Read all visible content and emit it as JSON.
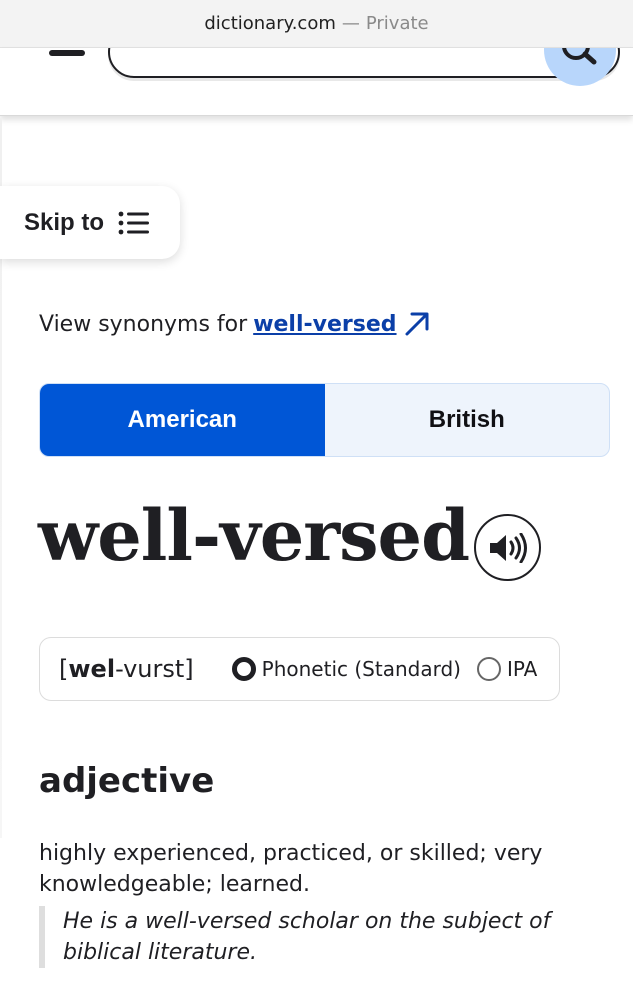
{
  "browser": {
    "domain": "dictionary.com",
    "separator": "—",
    "mode": "Private"
  },
  "header": {
    "menu_icon": "hamburger-icon",
    "search_icon": "search-icon"
  },
  "skip_to": {
    "label": "Skip to",
    "icon": "list-icon"
  },
  "synonyms": {
    "prefix": "View synonyms for",
    "link": "well-versed",
    "icon": "external-arrow-icon"
  },
  "dialect_tabs": [
    {
      "label": "American",
      "active": true
    },
    {
      "label": "British",
      "active": false
    }
  ],
  "entry": {
    "headword": "well-versed",
    "audio_icon": "speaker-icon",
    "pronunciation": {
      "open_bracket": "[",
      "stressed": "wel",
      "rest": "-vurst",
      "close_bracket": "]",
      "options": [
        {
          "label": "Phonetic (Standard)",
          "selected": true
        },
        {
          "label": "IPA",
          "selected": false
        }
      ]
    },
    "part_of_speech": "adjective",
    "definition": "highly experienced, practiced, or skilled; very knowledgeable; learned.",
    "example": "He is a well-versed scholar on the subject of biblical literature."
  },
  "colors": {
    "accent": "#0056d6",
    "link": "#0b3fa8",
    "search_button": "#b8d6fb",
    "text": "#1f1f23"
  }
}
